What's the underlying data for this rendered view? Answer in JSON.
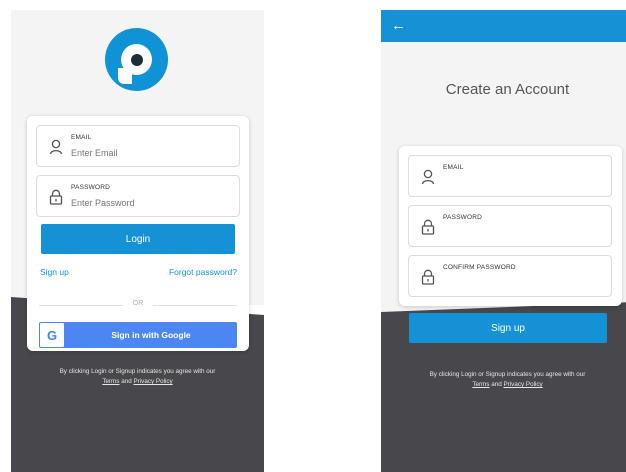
{
  "login": {
    "email": {
      "label": "EMAIL",
      "placeholder": "Enter Email"
    },
    "password": {
      "label": "PASSWORD",
      "placeholder": "Enter Password"
    },
    "login_button": "Login",
    "signup_link": "Sign up",
    "forgot_link": "Forgot password?",
    "divider_text": "OR",
    "google_button": "Sign in with Google",
    "google_letter": "G",
    "legal_prefix": "By clicking Login or Signup indicates you agree with our",
    "terms": "Terms",
    "legal_and": " and ",
    "privacy": "Privacy Policy"
  },
  "signup": {
    "back_icon": "←",
    "title": "Create an Account",
    "email": {
      "label": "EMAIL"
    },
    "password": {
      "label": "PASSWORD"
    },
    "confirm": {
      "label": "CONFIRM PASSWORD"
    },
    "signup_button": "Sign up",
    "legal_prefix": "By clicking Login or Signup indicates you agree with our",
    "terms": "Terms",
    "legal_and": " and ",
    "privacy": "Privacy Policy"
  },
  "colors": {
    "primary": "#1592d6",
    "google_blue": "#4c86f3",
    "dark_bg": "#48474b",
    "light_bg": "#f4f4f4"
  },
  "icons": {
    "user": "user-icon",
    "lock": "lock-icon",
    "logo": "app-logo",
    "google": "google-icon",
    "back": "back-arrow-icon"
  }
}
